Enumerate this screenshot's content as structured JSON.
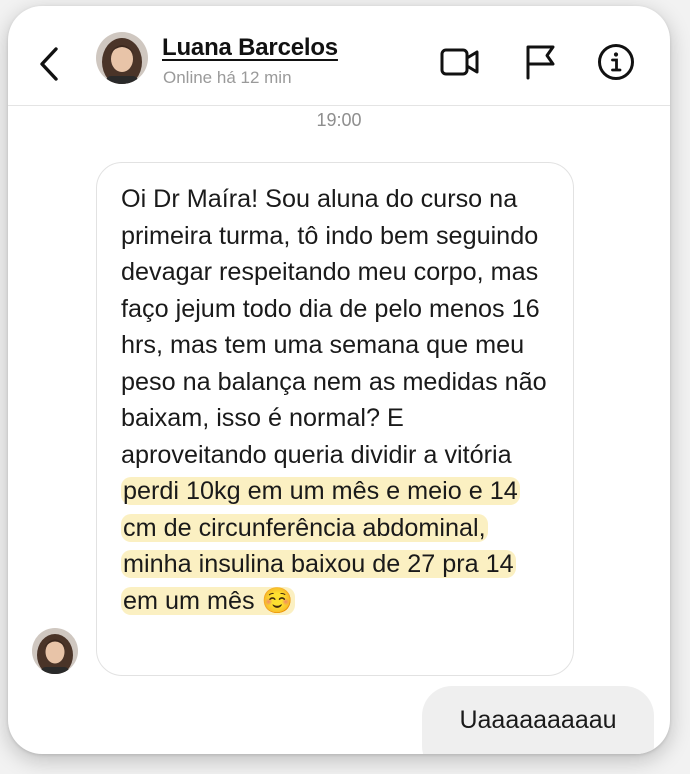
{
  "header": {
    "contact_name": "Luana Barcelos",
    "status": "Online há 12 min",
    "icons": [
      "chevron-left-icon",
      "video-camera-icon",
      "flag-icon",
      "info-icon"
    ]
  },
  "thread": {
    "timestamp": "19:00",
    "incoming": {
      "text": "Oi Dr Maíra! Sou aluna do curso na primeira turma, tô indo bem seguindo devagar respeitando meu corpo, mas faço jejum todo dia de pelo menos 16 hrs, mas tem uma semana que meu peso na balança nem as medidas não baixam, isso é normal? E aproveitando queria dividir a vitória",
      "highlighted": "perdi 10kg em um mês e meio e 14 cm de circunferência abdominal, minha insulina baixou de 27 pra 14 em um mês",
      "emoji": "☺️"
    },
    "outgoing": {
      "text": "Uaaaaaaaaau"
    }
  },
  "colors": {
    "highlight": "#fbf0c2",
    "outgoing_bubble": "#efefef",
    "bubble_border": "#e2e2e2",
    "muted_text": "#9a9a9a"
  }
}
